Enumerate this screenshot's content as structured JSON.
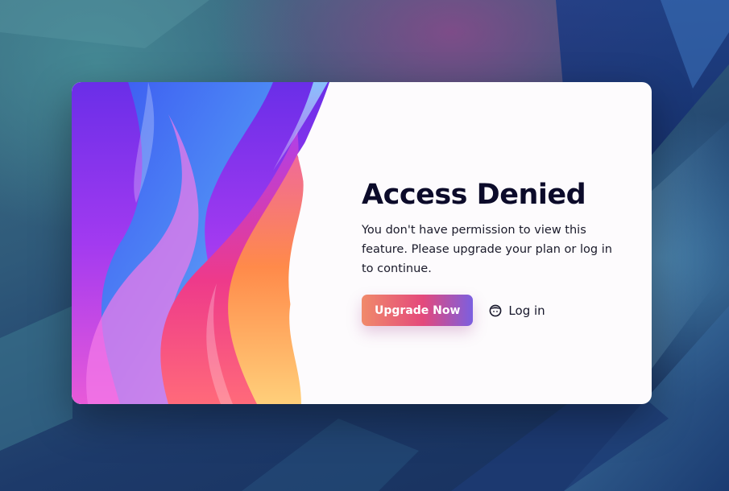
{
  "dialog": {
    "title": "Access Denied",
    "message": "You don't have permission to view this feature. Please upgrade your plan or log in to continue.",
    "upgrade_label": "Upgrade Now",
    "login_label": "Log in",
    "login_icon": "user-face-icon"
  },
  "colors": {
    "title": "#0c0b2a",
    "dialog_bg": "#fdfbfd",
    "upgrade_gradient": [
      "#f08a6a",
      "#e4497c",
      "#7b5fe0"
    ]
  }
}
